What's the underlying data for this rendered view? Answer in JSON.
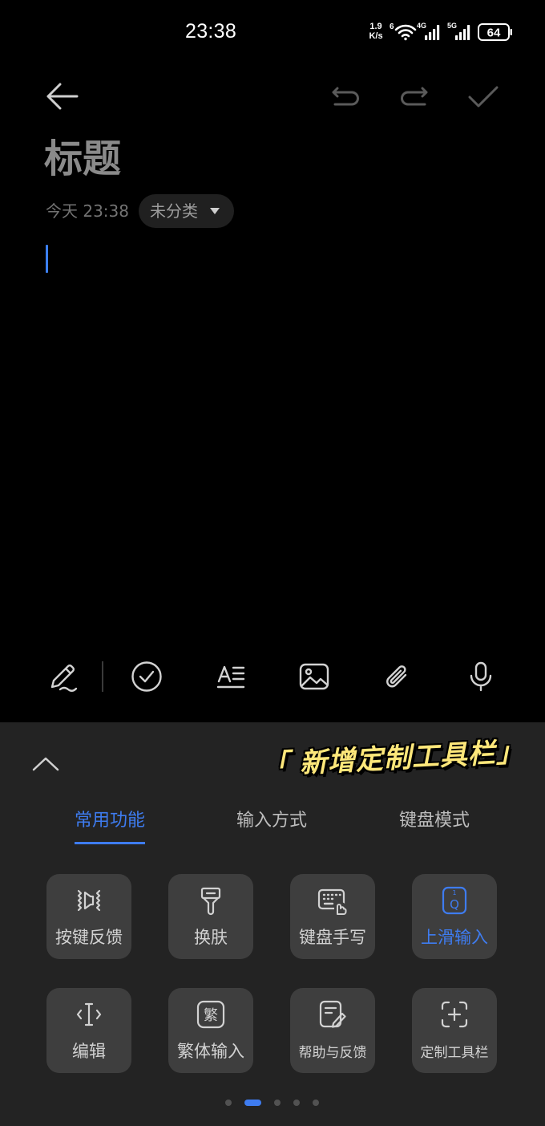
{
  "status_bar": {
    "time": "23:38",
    "net_speed": "1.9",
    "net_speed_unit": "K/s",
    "wifi_icon": "wifi-6-icon",
    "wifi_generation": "6",
    "cell_1": {
      "icon": "cellular-signal-icon",
      "label": "4G",
      "signal_level": 4,
      "signal_max": 4
    },
    "cell_2": {
      "icon": "cellular-signal-icon",
      "label": "5G",
      "signal_level": 4,
      "signal_max": 4
    },
    "battery": {
      "icon": "battery-icon",
      "level": "64"
    }
  },
  "nav": {
    "back_icon": "back-arrow-icon",
    "undo_icon": "undo-icon",
    "redo_icon": "redo-icon",
    "done_icon": "check-icon"
  },
  "note": {
    "title_placeholder": "标题",
    "date": "今天 23:38",
    "category": "未分类",
    "category_icon": "dropdown-triangle-icon"
  },
  "toolbar": {
    "items": [
      {
        "icon": "handwriting-pen-icon"
      },
      {
        "icon": "checklist-icon"
      },
      {
        "icon": "text-style-icon"
      },
      {
        "icon": "insert-image-icon"
      },
      {
        "icon": "attachment-icon"
      },
      {
        "icon": "voice-input-icon"
      }
    ]
  },
  "keyboard_panel": {
    "collapse_icon": "chevron-up-icon",
    "annotation": "「 新增定制工具栏」",
    "tabs": [
      {
        "label": "常用功能",
        "active": true
      },
      {
        "label": "输入方式",
        "active": false
      },
      {
        "label": "键盘模式",
        "active": false
      }
    ],
    "tiles": [
      {
        "label": "按键反馈",
        "icon": "haptic-feedback-icon"
      },
      {
        "label": "换肤",
        "icon": "skin-brush-icon"
      },
      {
        "label": "键盘手写",
        "icon": "keyboard-handwriting-icon"
      },
      {
        "label": "上滑输入",
        "icon": "swipe-input-icon",
        "icon_text_top": "1",
        "icon_text": "Q",
        "active": true
      },
      {
        "label": "编辑",
        "icon": "edit-cursor-icon"
      },
      {
        "label": "繁体输入",
        "icon": "traditional-chinese-icon",
        "icon_text": "繁"
      },
      {
        "label": "帮助与反馈",
        "icon": "help-feedback-icon"
      },
      {
        "label": "定制工具栏",
        "icon": "customize-toolbar-icon"
      }
    ],
    "pagination": {
      "pages": 5,
      "current": 2
    }
  },
  "colors": {
    "background": "#000000",
    "panel": "#232323",
    "tile": "#3e3e3e",
    "accent": "#3e7cf0",
    "annotation": "#fde77a",
    "icon": "#d2d2d2",
    "disabled": "#5a5a5a"
  }
}
